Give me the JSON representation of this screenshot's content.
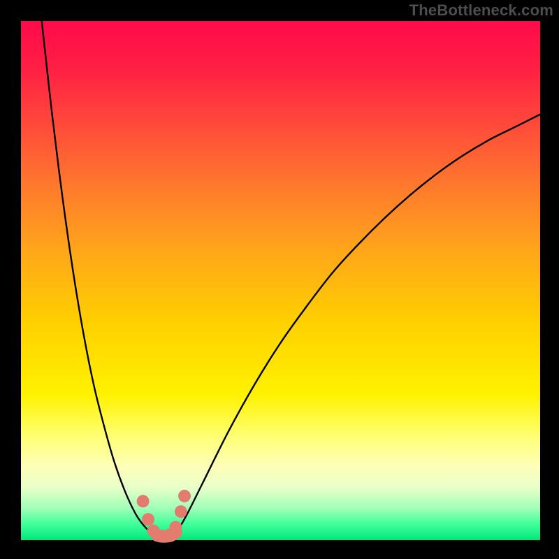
{
  "watermark": "TheBottleneck.com",
  "chart_data": {
    "type": "line",
    "title": "",
    "xlabel": "",
    "ylabel": "",
    "xlim": [
      0,
      100
    ],
    "ylim": [
      0,
      100
    ],
    "grid": false,
    "legend": false,
    "series": [
      {
        "name": "left-curve",
        "x": [
          4.0,
          6.0,
          8.0,
          10.0,
          12.0,
          14.0,
          16.0,
          18.0,
          20.0,
          22.0,
          23.5,
          25.0,
          26.2
        ],
        "y": [
          100.0,
          82.0,
          66.0,
          52.0,
          40.0,
          30.0,
          22.0,
          15.0,
          9.5,
          5.2,
          3.0,
          1.5,
          0.8
        ]
      },
      {
        "name": "right-curve",
        "x": [
          30.0,
          32.0,
          35.0,
          40.0,
          45.0,
          50.0,
          55.0,
          60.0,
          65.0,
          70.0,
          75.0,
          80.0,
          85.0,
          90.0,
          95.0,
          100.0
        ],
        "y": [
          1.5,
          5.0,
          11.0,
          21.0,
          30.0,
          38.0,
          45.0,
          51.5,
          57.0,
          62.0,
          66.5,
          70.5,
          74.0,
          77.0,
          79.5,
          82.0
        ]
      },
      {
        "name": "valley-floor",
        "x": [
          26.2,
          27.0,
          28.0,
          29.0,
          30.0
        ],
        "y": [
          0.8,
          0.6,
          0.6,
          0.8,
          1.5
        ]
      }
    ],
    "markers": {
      "name": "highlight-dots",
      "color": "#e37b6f",
      "points": [
        {
          "x": 23.5,
          "y": 7.5
        },
        {
          "x": 24.5,
          "y": 4.0
        },
        {
          "x": 25.5,
          "y": 1.8
        },
        {
          "x": 27.0,
          "y": 0.8
        },
        {
          "x": 28.5,
          "y": 1.0
        },
        {
          "x": 29.8,
          "y": 2.5
        },
        {
          "x": 30.8,
          "y": 5.5
        },
        {
          "x": 31.5,
          "y": 8.5
        }
      ]
    },
    "colors": {
      "curve_stroke": "#000000",
      "marker_fill": "#e37b6f",
      "frame": "#000000"
    }
  }
}
